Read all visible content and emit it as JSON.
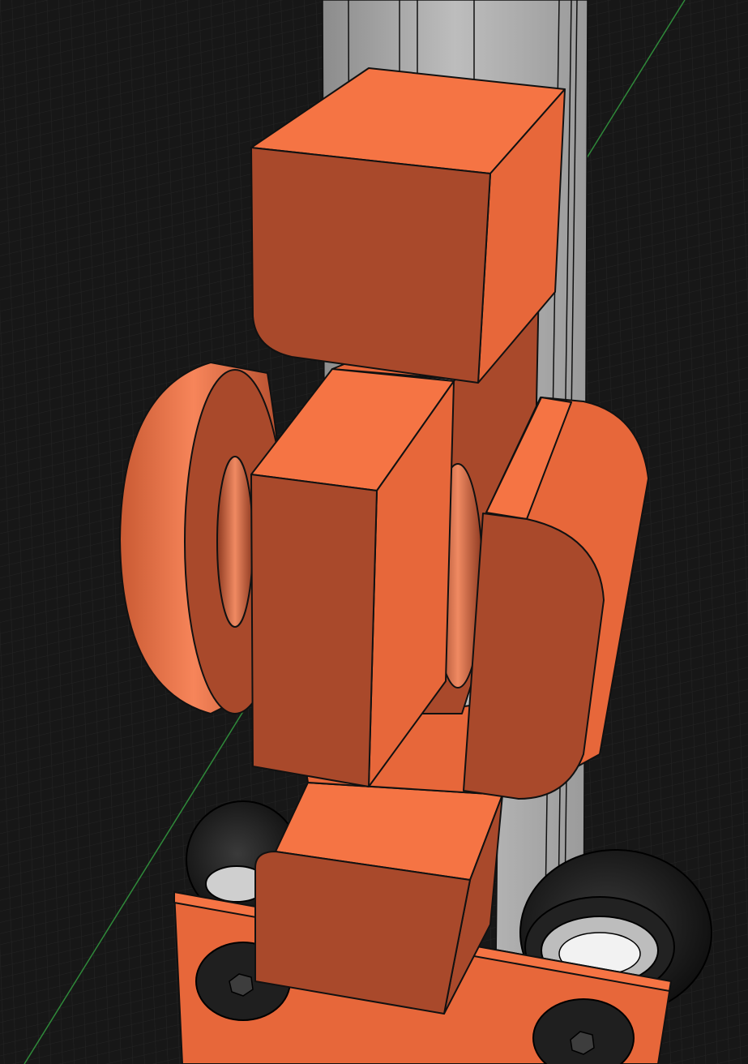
{
  "viewport": {
    "kind": "3d-cad-viewport",
    "background_color": "#171717",
    "grid_color": "#2a2a2a",
    "axis_color": "#2f8a3a"
  },
  "model": {
    "part_color_light": "#f57444",
    "part_color_mid": "#e7673a",
    "part_color_dark": "#a9492b",
    "rail_color": "#a6a6a6",
    "wheel_color": "#1a1a1a",
    "bearing_color": "#d6d6d6",
    "outline_color": "#111111"
  }
}
